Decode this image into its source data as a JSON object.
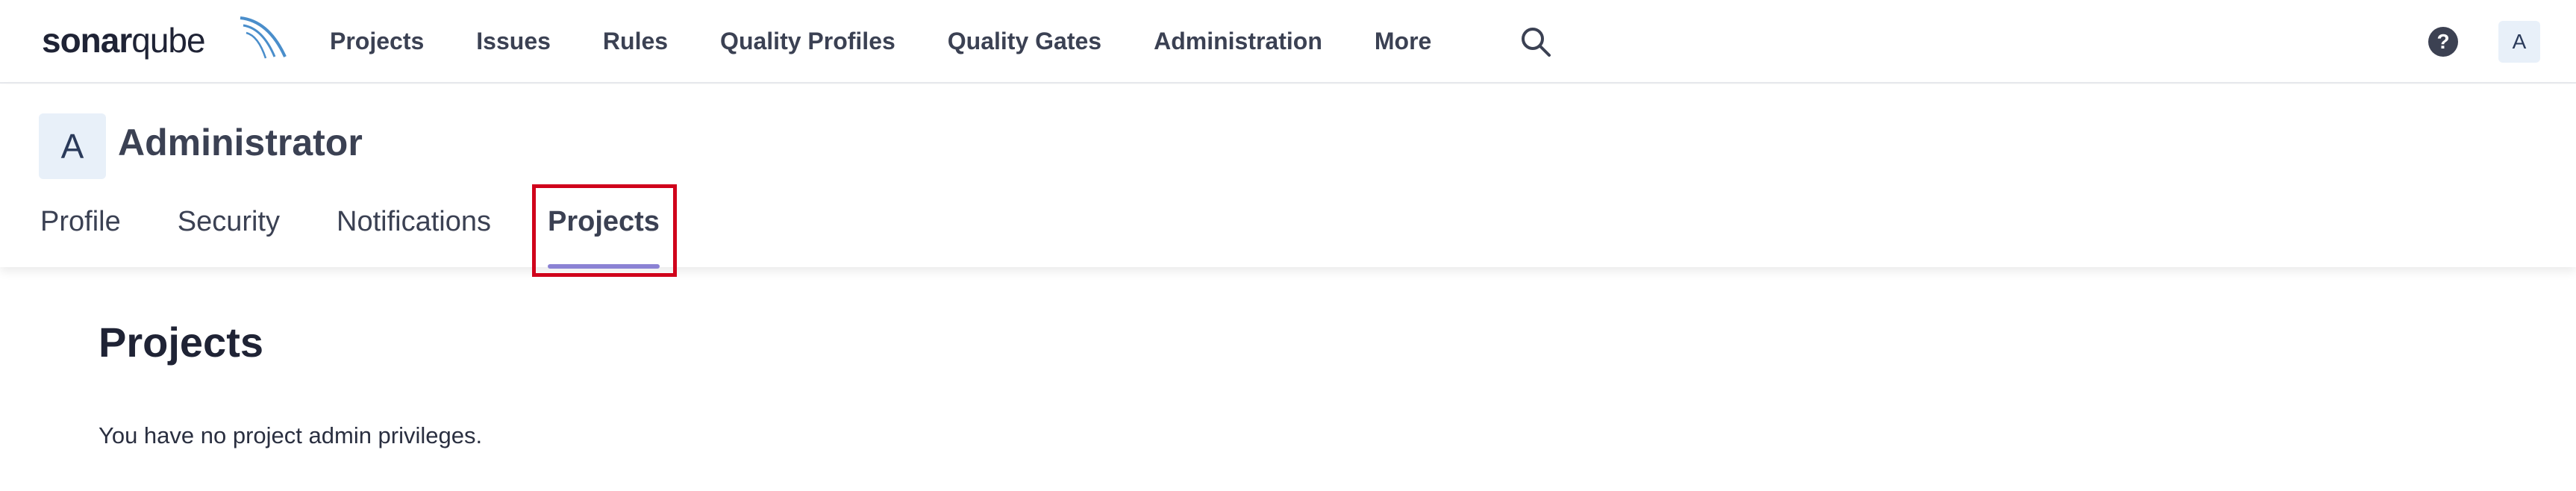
{
  "logo": {
    "bold_part": "sonar",
    "light_part": "qube"
  },
  "nav": {
    "items": [
      {
        "label": "Projects"
      },
      {
        "label": "Issues"
      },
      {
        "label": "Rules"
      },
      {
        "label": "Quality Profiles"
      },
      {
        "label": "Quality Gates"
      },
      {
        "label": "Administration"
      },
      {
        "label": "More"
      }
    ],
    "search_icon": "search-icon",
    "help_icon": "question-circle-icon",
    "user_avatar_initial": "A"
  },
  "account": {
    "avatar_initial": "A",
    "name": "Administrator",
    "tabs": [
      {
        "label": "Profile"
      },
      {
        "label": "Security"
      },
      {
        "label": "Notifications"
      },
      {
        "label": "Projects",
        "active": true
      }
    ]
  },
  "main": {
    "title": "Projects",
    "message": "You have no project admin privileges."
  },
  "colors": {
    "tab_underline": "#8b82d4",
    "highlight_border": "#d0021b",
    "avatar_bg": "#e8f0f9"
  }
}
